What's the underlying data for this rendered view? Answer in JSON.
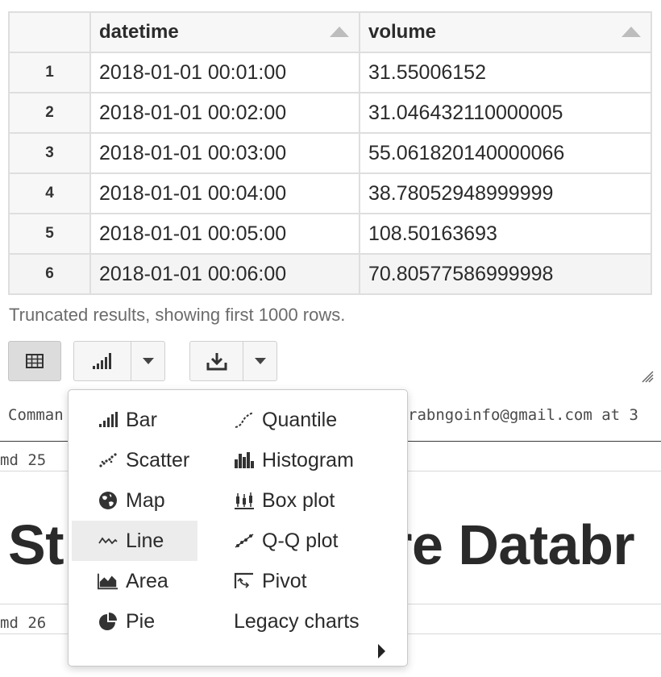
{
  "table": {
    "columns": [
      "datetime",
      "volume"
    ],
    "rows": [
      {
        "index": "1",
        "datetime": "2018-01-01 00:01:00",
        "volume": "31.55006152"
      },
      {
        "index": "2",
        "datetime": "2018-01-01 00:02:00",
        "volume": "31.046432110000005"
      },
      {
        "index": "3",
        "datetime": "2018-01-01 00:03:00",
        "volume": "55.061820140000066"
      },
      {
        "index": "4",
        "datetime": "2018-01-01 00:04:00",
        "volume": "38.78052948999999"
      },
      {
        "index": "5",
        "datetime": "2018-01-01 00:05:00",
        "volume": "108.50163693"
      },
      {
        "index": "6",
        "datetime": "2018-01-01 00:06:00",
        "volume": "70.80577586999998"
      }
    ],
    "truncated_note": "Truncated results, showing first 1000 rows."
  },
  "toolbar": {
    "table_view_icon": "table-grid-icon",
    "chart_icon": "bar-chart-icon",
    "download_icon": "download-icon"
  },
  "background": {
    "command_left": "Comman",
    "command_right": "rabngoinfo@gmail.com at 3",
    "cmd25": "md 25",
    "heading_left": "St",
    "heading_right": "ure Databr",
    "cmd26": "md 26"
  },
  "chart_menu": {
    "left": [
      {
        "label": "Bar",
        "icon": "bar-icon"
      },
      {
        "label": "Scatter",
        "icon": "scatter-icon"
      },
      {
        "label": "Map",
        "icon": "globe-icon"
      },
      {
        "label": "Line",
        "icon": "line-icon",
        "highlighted": true
      },
      {
        "label": "Area",
        "icon": "area-icon"
      },
      {
        "label": "Pie",
        "icon": "pie-icon"
      }
    ],
    "right": [
      {
        "label": "Quantile",
        "icon": "quantile-icon"
      },
      {
        "label": "Histogram",
        "icon": "histogram-icon"
      },
      {
        "label": "Box plot",
        "icon": "box-plot-icon"
      },
      {
        "label": "Q-Q plot",
        "icon": "qq-plot-icon"
      },
      {
        "label": "Pivot",
        "icon": "pivot-icon"
      },
      {
        "label": "Legacy charts",
        "icon": ""
      }
    ]
  },
  "colors": {
    "highlight": "#ececec",
    "active_button": "#dcdcdc",
    "border": "#dedede"
  }
}
